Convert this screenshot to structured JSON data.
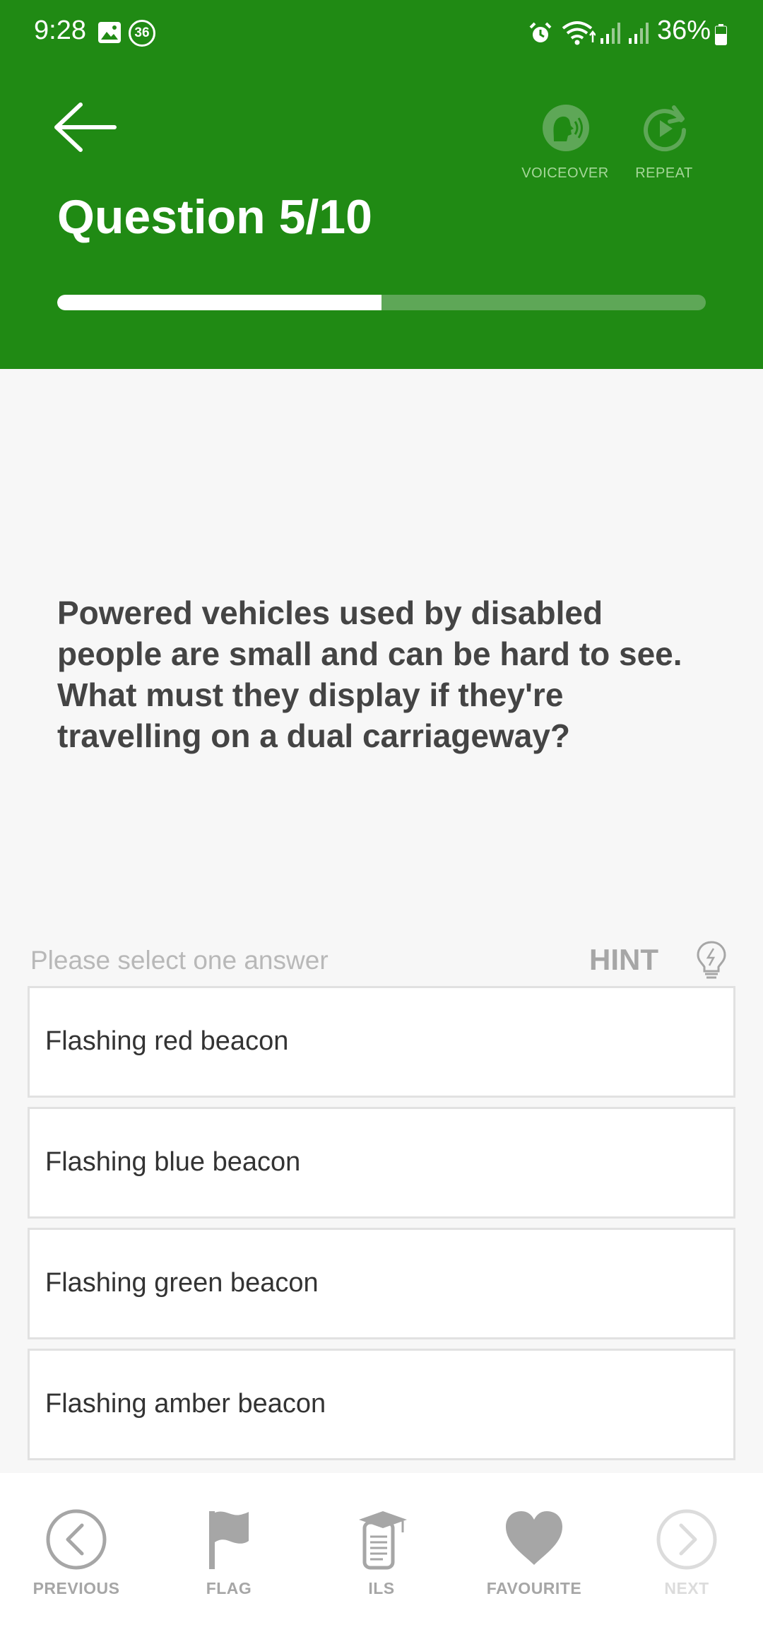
{
  "status_bar": {
    "time": "9:28",
    "badge": "36",
    "battery": "36%"
  },
  "header": {
    "title": "Question 5/10",
    "voiceover_label": "VOICEOVER",
    "repeat_label": "REPEAT",
    "progress": 0.5
  },
  "question": {
    "text": "Powered vehicles used by disabled people are small and can be hard to see. What must they display if they're travelling on a dual carriageway?"
  },
  "answers_section": {
    "prompt": "Please select one answer",
    "hint_label": "HINT",
    "options": [
      "Flashing red beacon",
      "Flashing blue beacon",
      "Flashing green beacon",
      "Flashing amber beacon"
    ]
  },
  "bottom_nav": {
    "previous": "PREVIOUS",
    "flag": "FLAG",
    "ils": "ILS",
    "favourite": "FAVOURITE",
    "next": "NEXT"
  },
  "colors": {
    "header_green": "#208a14",
    "progress_track": "#5ea757",
    "icon_gray": "#a6a6a6"
  }
}
